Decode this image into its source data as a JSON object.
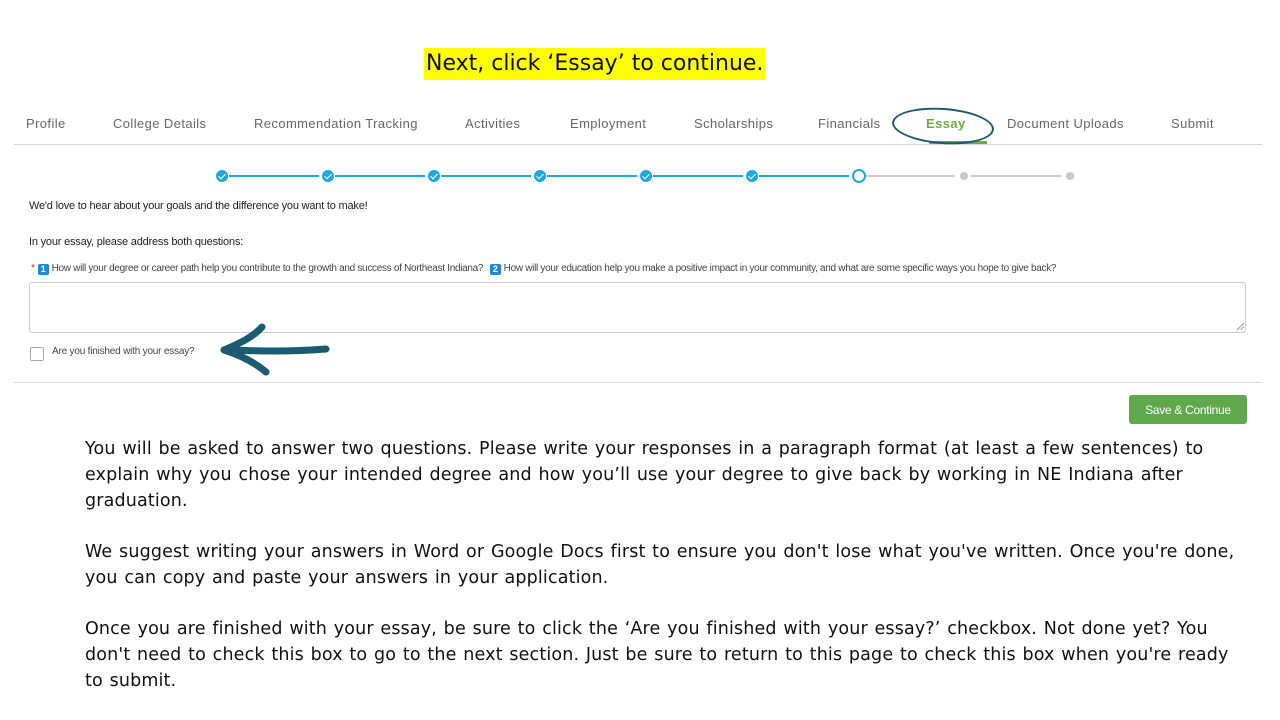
{
  "headline": "Next, click ‘Essay’ to continue.",
  "tabs": [
    {
      "label": "Profile",
      "active": false
    },
    {
      "label": "College Details",
      "active": false
    },
    {
      "label": "Recommendation Tracking",
      "active": false
    },
    {
      "label": "Activities",
      "active": false
    },
    {
      "label": "Employment",
      "active": false
    },
    {
      "label": "Scholarships",
      "active": false
    },
    {
      "label": "Financials",
      "active": false
    },
    {
      "label": "Essay",
      "active": true
    },
    {
      "label": "Document Uploads",
      "active": false
    },
    {
      "label": "Submit",
      "active": false
    }
  ],
  "stepper": {
    "steps": [
      "done",
      "done",
      "done",
      "done",
      "done",
      "done",
      "current",
      "todo",
      "todo"
    ]
  },
  "form": {
    "intro": "We'd love to hear about your goals and the difference you want to make!",
    "instructions": "In your essay, please address both questions:",
    "required_mark": "*",
    "q1_number": "1",
    "q1": "How will your degree or career path help you contribute to the growth and success of Northeast Indiana?",
    "q2_number": "2",
    "q2": "How will your education help you make a positive impact in your community, and what are some specific ways you hope to give back?",
    "essay_value": "",
    "finished_label": "Are you finished with your essay?",
    "save_label": "Save & Continue"
  },
  "colors": {
    "highlight": "#ffff00",
    "active_tab": "#6aaa4d",
    "step_done": "#1ea8e0",
    "annotation": "#1a5b73",
    "save_button": "#5fa84c"
  },
  "icons": {
    "annotation_arrow": "arrow-left-icon",
    "annotation_circle": "circle-annotation",
    "step_done": "check-icon"
  },
  "notes": {
    "p1": "You will be asked to answer two questions. Please write your responses in a paragraph format (at least a few sentences) to explain why you chose your intended degree and how you’ll use your degree to give back by working in NE Indiana after graduation.",
    "p2": "We suggest writing your answers in Word or Google Docs first to ensure you don't lose what you've written. Once you're done, you can copy and paste your answers in your application.",
    "p3": "Once you are finished with your essay, be sure to click the ‘Are you finished with your essay?’ checkbox. Not done yet? You don't need to check this box to go to the next section. Just be sure to return to this page to check this box when you're ready to submit."
  }
}
